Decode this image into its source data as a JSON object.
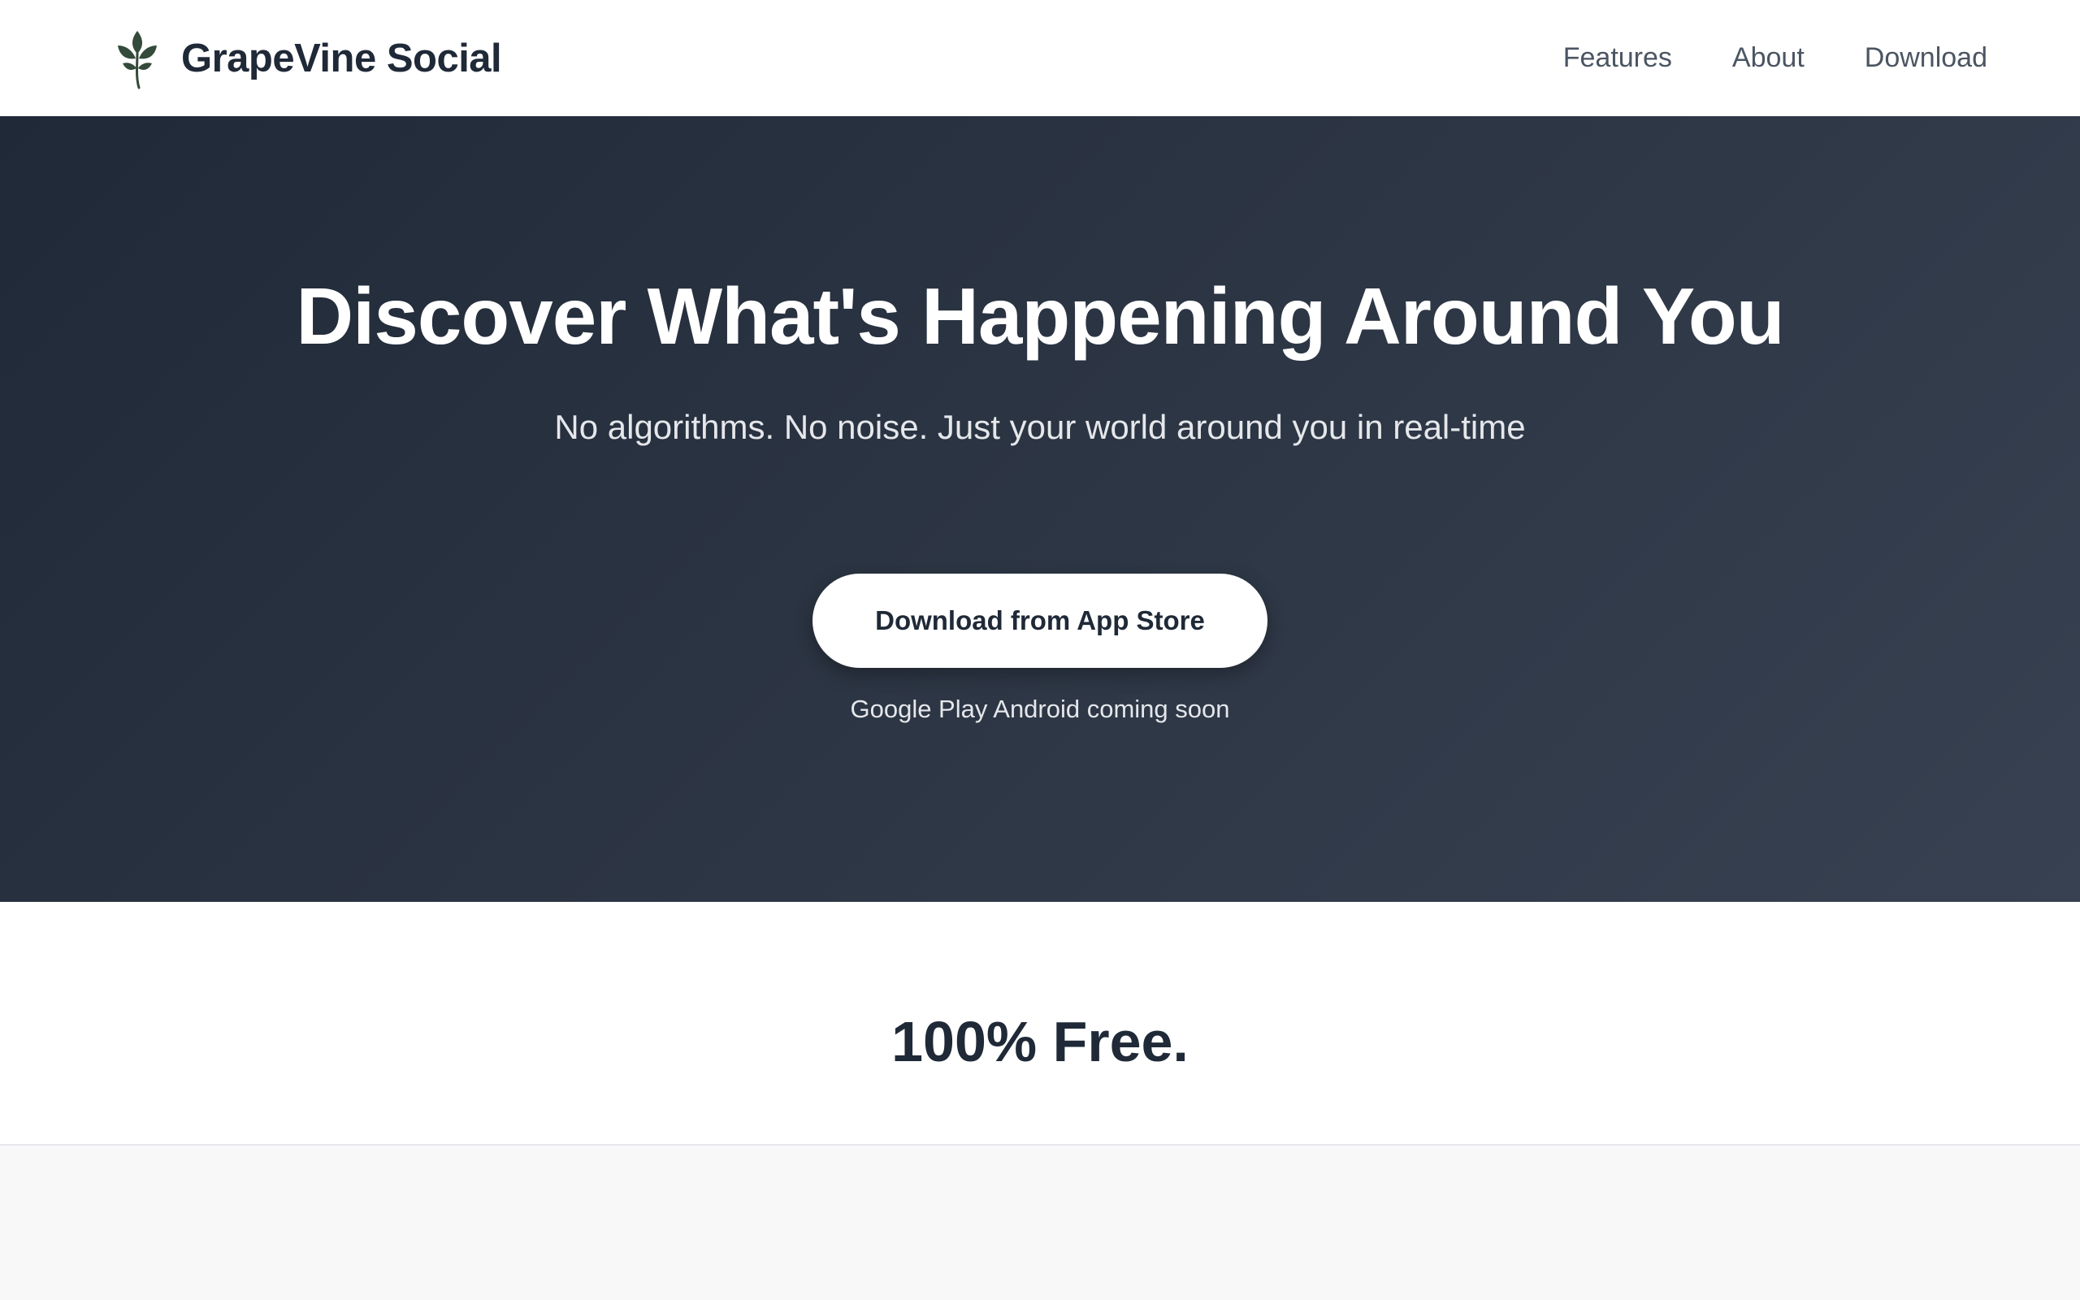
{
  "brand": {
    "name": "GrapeVine Social",
    "logo_icon": "leaf-icon"
  },
  "nav": {
    "items": [
      {
        "label": "Features"
      },
      {
        "label": "About"
      },
      {
        "label": "Download"
      }
    ]
  },
  "hero": {
    "title": "Discover What's Happening Around You",
    "subtitle": "No algorithms. No noise. Just your world around you in real-time",
    "cta_label": "Download from App Store",
    "note": "Google Play Android coming soon"
  },
  "pricing": {
    "title": "100% Free."
  },
  "colors": {
    "dark": "#1f2937",
    "hero_gradient_start": "#1f2937",
    "hero_gradient_end": "#374151",
    "button_bg": "#ffffff"
  }
}
